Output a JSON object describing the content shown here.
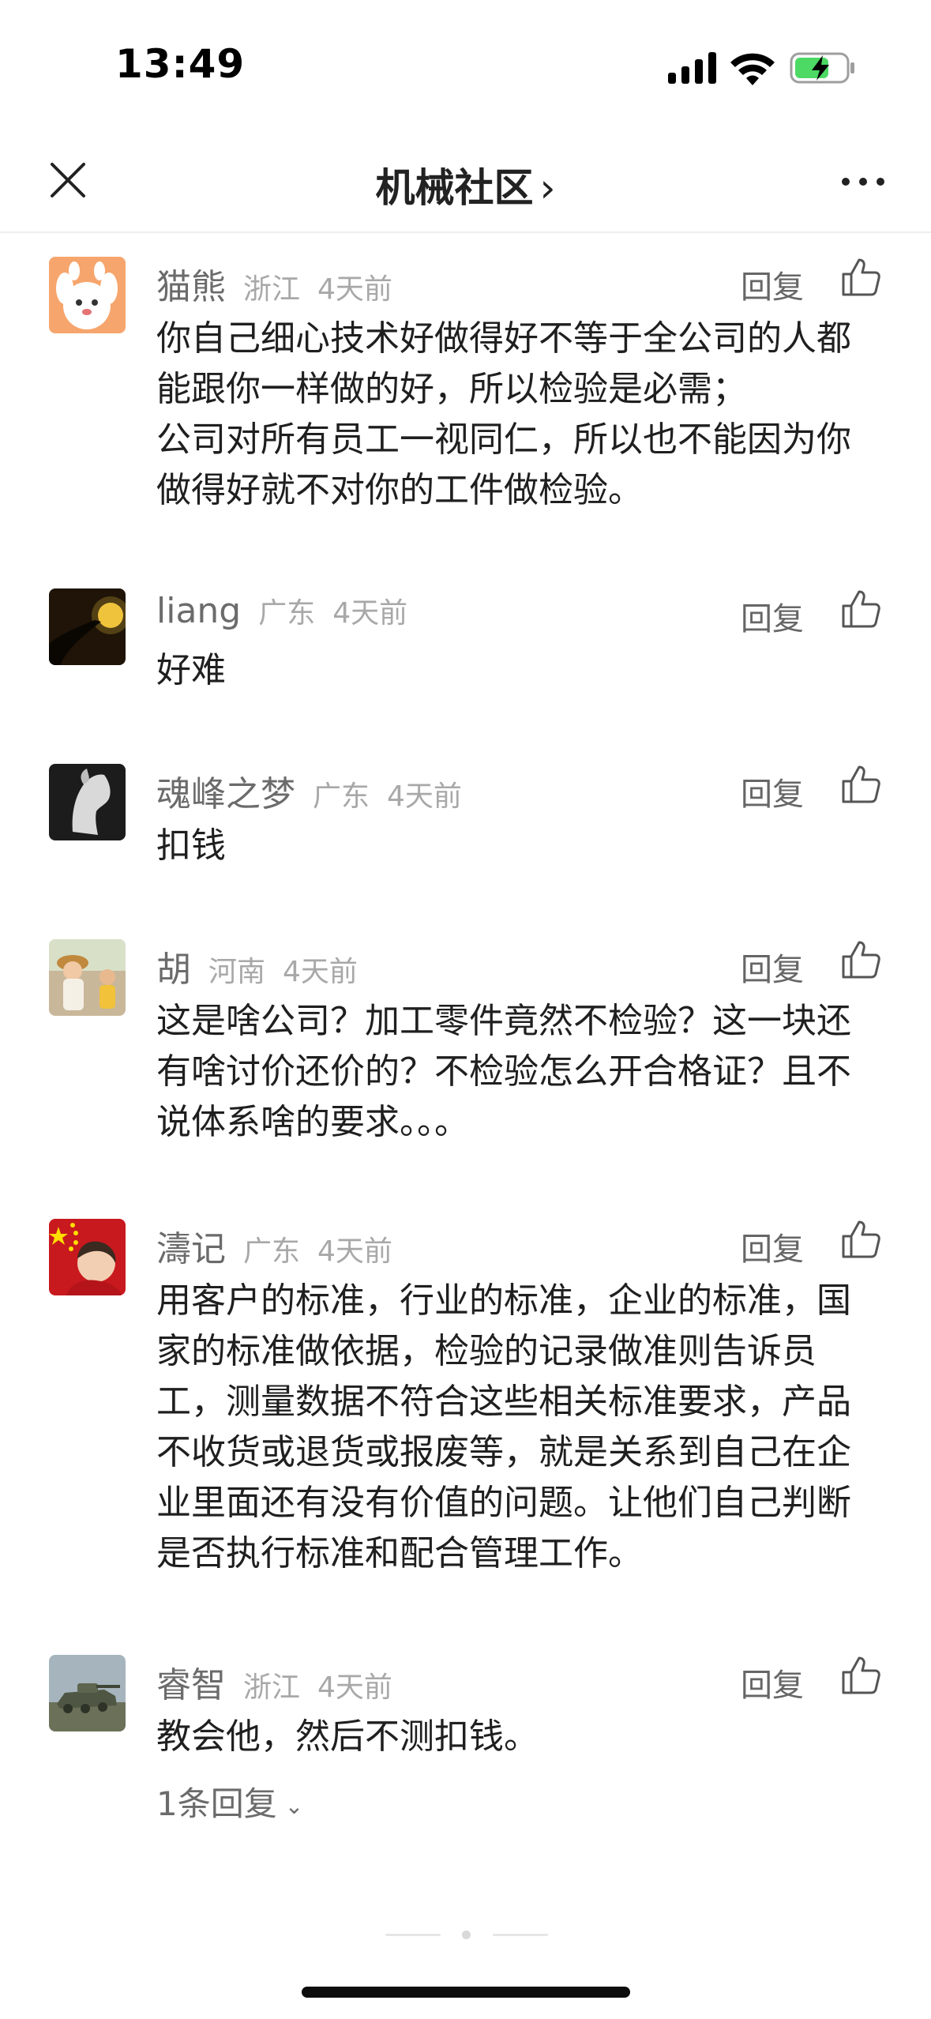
{
  "status_bar": {
    "time": "13:49",
    "icons": [
      "signal-icon",
      "wifi-icon",
      "battery-charging-icon"
    ]
  },
  "nav": {
    "title": "机械社区",
    "title_chevron": "›",
    "icons": [
      "close-icon",
      "more-icon"
    ]
  },
  "colors": {
    "text_primary": "#1f1f1f",
    "text_secondary": "#6b6b6b",
    "text_muted": "#a8a8a8",
    "battery_green": "#4cd964"
  },
  "comments": [
    {
      "name": "猫熊",
      "location": "浙江",
      "time": "4天前",
      "reply_label": "回复",
      "lines": [
        "你自己细心技术好做得好不等于全公司的人都",
        "能跟你一样做的好，所以检验是必需；",
        "公司对所有员工一视同仁，所以也不能因为你",
        "做得好就不对你的工件做检验。"
      ]
    },
    {
      "name": "liang",
      "location": "广东",
      "time": "4天前",
      "reply_label": "回复",
      "lines": [
        "好难"
      ]
    },
    {
      "name": "魂峰之梦",
      "location": "广东",
      "time": "4天前",
      "reply_label": "回复",
      "lines": [
        "扣钱"
      ]
    },
    {
      "name": "胡",
      "location": "河南",
      "time": "4天前",
      "reply_label": "回复",
      "lines": [
        "这是啥公司？加工零件竟然不检验？这一块还",
        "有啥讨价还价的？不检验怎么开合格证？且不",
        "说体系啥的要求。。。"
      ]
    },
    {
      "name": "濤记",
      "location": "广东",
      "time": "4天前",
      "reply_label": "回复",
      "lines": [
        "用客户的标准，行业的标准，企业的标准，国",
        "家的标准做依据，检验的记录做准则告诉员",
        "工，测量数据不符合这些相关标准要求，产品",
        "不收货或退货或报废等，就是关系到自己在企",
        "业里面还有没有价值的问题。让他们自己判断",
        "是否执行标准和配合管理工作。"
      ]
    },
    {
      "name": "睿智",
      "location": "浙江",
      "time": "4天前",
      "reply_label": "回复",
      "lines": [
        "教会他，然后不测扣钱。"
      ]
    }
  ],
  "replies_toggle": {
    "label": "1条回复",
    "chevron": "⌄"
  }
}
